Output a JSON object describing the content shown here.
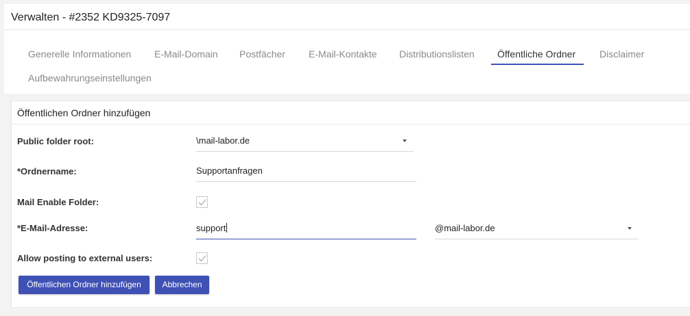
{
  "header": {
    "title": "Verwalten - #2352 KD9325-7097"
  },
  "tabs": [
    {
      "label": "Generelle Informationen"
    },
    {
      "label": "E-Mail-Domain"
    },
    {
      "label": "Postfächer"
    },
    {
      "label": "E-Mail-Kontakte"
    },
    {
      "label": "Distributionslisten"
    },
    {
      "label": "Öffentliche Ordner",
      "active": true
    },
    {
      "label": "Disclaimer"
    },
    {
      "label": "Aufbewahrungseinstellungen"
    }
  ],
  "form": {
    "title": "Öffentlichen Ordner hinzufügen",
    "public_folder_root": {
      "label": "Public folder root:",
      "value": "\\mail-labor.de"
    },
    "folder_name": {
      "label": "*Ordnername:",
      "value": "Supportanfragen"
    },
    "mail_enable": {
      "label": "Mail Enable Folder:",
      "checked": true
    },
    "email": {
      "label": "*E-Mail-Adresse:",
      "value": "support",
      "domain": "@mail-labor.de"
    },
    "allow_external": {
      "label": "Allow posting to external users:",
      "checked": true
    },
    "buttons": {
      "submit": "Öffentlichen Ordner hinzufügen",
      "cancel": "Abbrechen"
    }
  },
  "colors": {
    "accent": "#3f51b5",
    "background": "#f3f3f3",
    "card": "#ffffff"
  }
}
